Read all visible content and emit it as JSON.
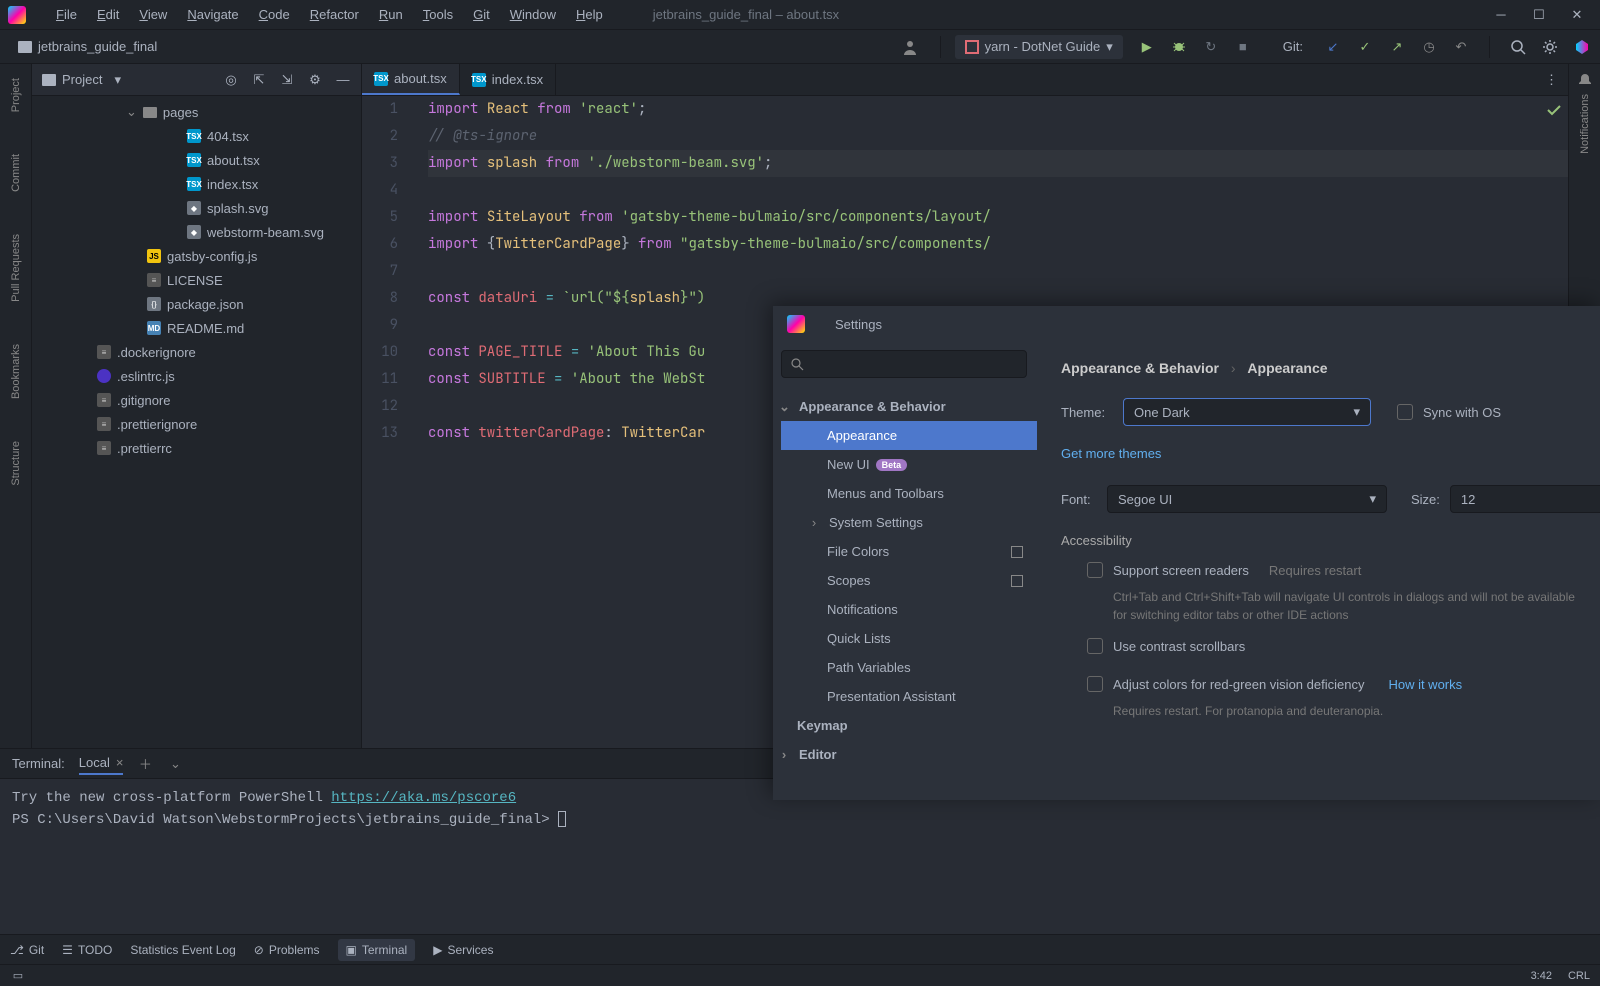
{
  "window": {
    "title": "jetbrains_guide_final – about.tsx"
  },
  "menu": [
    "File",
    "Edit",
    "View",
    "Navigate",
    "Code",
    "Refactor",
    "Run",
    "Tools",
    "Git",
    "Window",
    "Help"
  ],
  "toolbar": {
    "project_name": "jetbrains_guide_final",
    "run_config": "yarn - DotNet Guide",
    "git_label": "Git:"
  },
  "left_gutters": [
    "Project",
    "Commit",
    "Pull Requests",
    "Bookmarks",
    "Structure"
  ],
  "right_gutters": [
    "Notifications"
  ],
  "project_panel": {
    "title": "Project",
    "tree": [
      {
        "indent": 110,
        "type": "folder-open",
        "label": "pages",
        "expand": "⌄"
      },
      {
        "indent": 155,
        "type": "tsx",
        "label": "404.tsx"
      },
      {
        "indent": 155,
        "type": "tsx",
        "label": "about.tsx"
      },
      {
        "indent": 155,
        "type": "tsx",
        "label": "index.tsx"
      },
      {
        "indent": 155,
        "type": "svg",
        "label": "splash.svg"
      },
      {
        "indent": 155,
        "type": "svg",
        "label": "webstorm-beam.svg"
      },
      {
        "indent": 115,
        "type": "js",
        "label": "gatsby-config.js"
      },
      {
        "indent": 115,
        "type": "txt",
        "label": "LICENSE"
      },
      {
        "indent": 115,
        "type": "json",
        "label": "package.json"
      },
      {
        "indent": 115,
        "type": "md",
        "label": "README.md"
      },
      {
        "indent": 65,
        "type": "txt",
        "label": ".dockerignore"
      },
      {
        "indent": 65,
        "type": "eslint",
        "label": ".eslintrc.js"
      },
      {
        "indent": 65,
        "type": "txt",
        "label": ".gitignore"
      },
      {
        "indent": 65,
        "type": "txt",
        "label": ".prettierignore"
      },
      {
        "indent": 65,
        "type": "txt",
        "label": ".prettierrc"
      }
    ]
  },
  "tabs": [
    {
      "label": "about.tsx",
      "active": true
    },
    {
      "label": "index.tsx",
      "active": false
    }
  ],
  "code": {
    "lines": [
      [
        {
          "c": "kw",
          "t": "import"
        },
        {
          "c": "pln",
          "t": " "
        },
        {
          "c": "ident",
          "t": "React"
        },
        {
          "c": "pln",
          "t": " "
        },
        {
          "c": "kw",
          "t": "from"
        },
        {
          "c": "pln",
          "t": " "
        },
        {
          "c": "str",
          "t": "'react'"
        },
        {
          "c": "pln",
          "t": ";"
        }
      ],
      [
        {
          "c": "comment",
          "t": "// @ts-ignore"
        }
      ],
      [
        {
          "c": "kw",
          "t": "import"
        },
        {
          "c": "pln",
          "t": " "
        },
        {
          "c": "ident",
          "t": "splash"
        },
        {
          "c": "pln",
          "t": " "
        },
        {
          "c": "kw",
          "t": "from"
        },
        {
          "c": "pln",
          "t": " "
        },
        {
          "c": "str",
          "t": "'./webstorm-beam.svg'"
        },
        {
          "c": "pln",
          "t": ";"
        }
      ],
      [],
      [
        {
          "c": "kw",
          "t": "import"
        },
        {
          "c": "pln",
          "t": " "
        },
        {
          "c": "ident",
          "t": "SiteLayout"
        },
        {
          "c": "pln",
          "t": " "
        },
        {
          "c": "kw",
          "t": "from"
        },
        {
          "c": "pln",
          "t": " "
        },
        {
          "c": "str",
          "t": "'gatsby-theme-bulmaio/src/components/layout/"
        }
      ],
      [
        {
          "c": "kw",
          "t": "import"
        },
        {
          "c": "pln",
          "t": " {"
        },
        {
          "c": "ident",
          "t": "TwitterCardPage"
        },
        {
          "c": "pln",
          "t": "} "
        },
        {
          "c": "kw",
          "t": "from"
        },
        {
          "c": "pln",
          "t": " "
        },
        {
          "c": "str",
          "t": "\"gatsby-theme-bulmaio/src/components/"
        }
      ],
      [],
      [
        {
          "c": "kw",
          "t": "const"
        },
        {
          "c": "pln",
          "t": " "
        },
        {
          "c": "var",
          "t": "dataUri"
        },
        {
          "c": "pln",
          "t": " "
        },
        {
          "c": "op",
          "t": "="
        },
        {
          "c": "pln",
          "t": " "
        },
        {
          "c": "str",
          "t": "`url(\"${"
        },
        {
          "c": "ident",
          "t": "splash"
        },
        {
          "c": "str",
          "t": "}\")"
        }
      ],
      [],
      [
        {
          "c": "kw",
          "t": "const"
        },
        {
          "c": "pln",
          "t": " "
        },
        {
          "c": "var",
          "t": "PAGE_TITLE"
        },
        {
          "c": "pln",
          "t": " "
        },
        {
          "c": "op",
          "t": "="
        },
        {
          "c": "pln",
          "t": " "
        },
        {
          "c": "str",
          "t": "'About This Gu"
        }
      ],
      [
        {
          "c": "kw",
          "t": "const"
        },
        {
          "c": "pln",
          "t": " "
        },
        {
          "c": "var",
          "t": "SUBTITLE"
        },
        {
          "c": "pln",
          "t": " "
        },
        {
          "c": "op",
          "t": "="
        },
        {
          "c": "pln",
          "t": " "
        },
        {
          "c": "str",
          "t": "'About the WebSt"
        }
      ],
      [],
      [
        {
          "c": "kw",
          "t": "const"
        },
        {
          "c": "pln",
          "t": " "
        },
        {
          "c": "var",
          "t": "twitterCardPage"
        },
        {
          "c": "pln",
          "t": ": "
        },
        {
          "c": "ident",
          "t": "TwitterCar"
        }
      ]
    ],
    "current_line": 3
  },
  "terminal": {
    "title": "Terminal:",
    "tab": "Local",
    "line1_pre": "Try the new cross-platform PowerShell ",
    "line1_link": "https://aka.ms/pscore6",
    "prompt": "PS C:\\Users\\David Watson\\WebstormProjects\\jetbrains_guide_final> "
  },
  "bottom_bar": [
    "Git",
    "TODO",
    "Statistics Event Log",
    "Problems",
    "Terminal",
    "Services"
  ],
  "status": {
    "pos": "3:42",
    "sep": "CRL"
  },
  "settings": {
    "title": "Settings",
    "breadcrumb": [
      "Appearance & Behavior",
      "Appearance"
    ],
    "tree": [
      {
        "label": "Appearance & Behavior",
        "bold": true,
        "chev": "⌄"
      },
      {
        "label": "Appearance",
        "indent": true,
        "selected": true
      },
      {
        "label": "New UI",
        "indent": true,
        "beta": "Beta"
      },
      {
        "label": "Menus and Toolbars",
        "indent": true
      },
      {
        "label": "System Settings",
        "indent": true,
        "chev": "›"
      },
      {
        "label": "File Colors",
        "indent": true,
        "layout": true
      },
      {
        "label": "Scopes",
        "indent": true,
        "layout": true
      },
      {
        "label": "Notifications",
        "indent": true
      },
      {
        "label": "Quick Lists",
        "indent": true
      },
      {
        "label": "Path Variables",
        "indent": true
      },
      {
        "label": "Presentation Assistant",
        "indent": true
      },
      {
        "label": "Keymap",
        "bold": true
      },
      {
        "label": "Editor",
        "bold": true,
        "chev": "›"
      }
    ],
    "theme_label": "Theme:",
    "theme_value": "One Dark",
    "sync_label": "Sync with OS",
    "more_themes": "Get more themes",
    "font_label": "Font:",
    "font_value": "Segoe UI",
    "size_label": "Size:",
    "size_value": "12",
    "accessibility": "Accessibility",
    "screen_readers": "Support screen readers",
    "requires_restart": "Requires restart",
    "sr_hint": "Ctrl+Tab and Ctrl+Shift+Tab will navigate UI controls in dialogs and will not be available for switching editor tabs or other IDE actions",
    "contrast": "Use contrast scrollbars",
    "colorblind": "Adjust colors for red-green vision deficiency",
    "how_it_works": "How it works",
    "colorblind_hint": "Requires restart. For protanopia and deuteranopia."
  }
}
